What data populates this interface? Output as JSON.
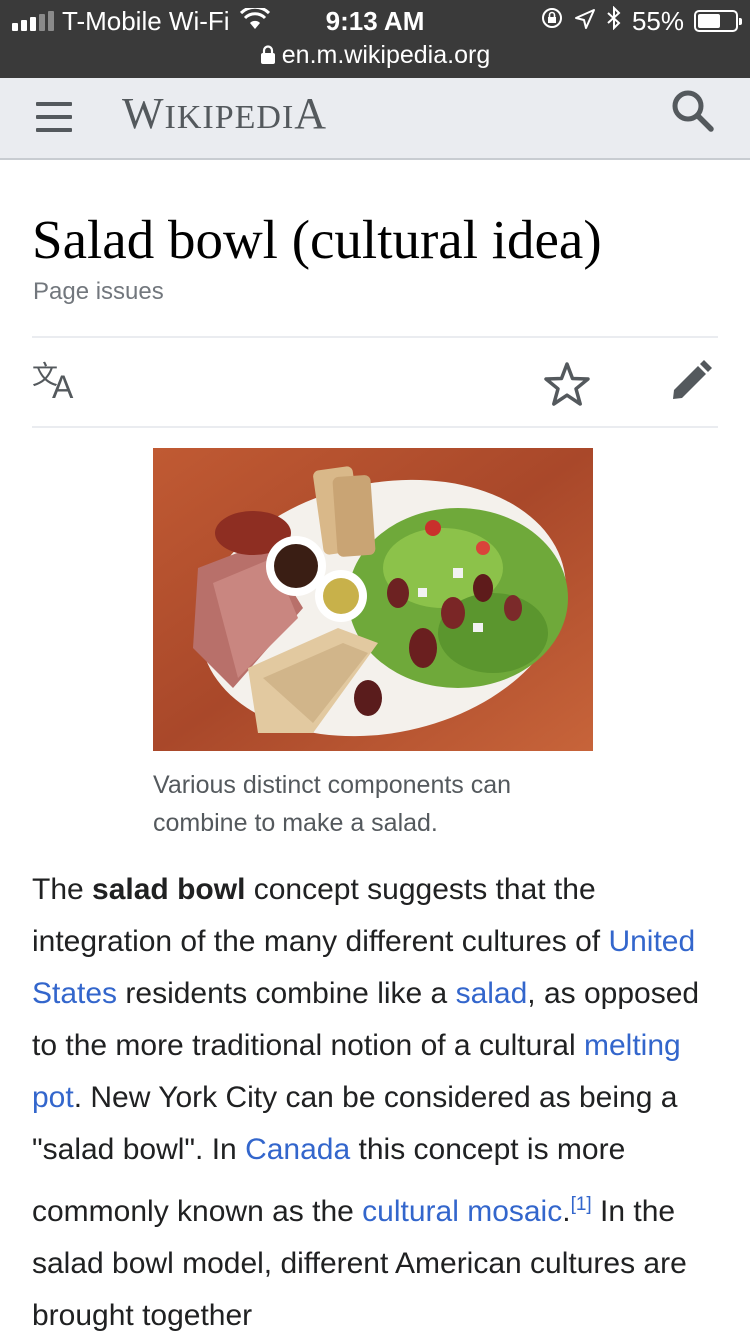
{
  "status_bar": {
    "carrier": "T-Mobile Wi-Fi",
    "time": "9:13 AM",
    "battery_percent": "55%",
    "battery_level": 0.55,
    "url": "en.m.wikipedia.org",
    "icons": [
      "signal-icon",
      "wifi-icon",
      "orientation-lock-icon",
      "location-arrow-icon",
      "bluetooth-icon",
      "battery-icon",
      "lock-icon"
    ]
  },
  "header": {
    "wordmark": "Wikipedia",
    "icons": [
      "menu-icon",
      "search-icon"
    ],
    "background": "#eaecf0"
  },
  "article": {
    "title": "Salad bowl (cultural idea)",
    "page_issues": "Page issues",
    "action_icons": [
      "language-icon",
      "watch-star-icon",
      "edit-pencil-icon"
    ],
    "image": {
      "caption": "Various distinct components can combine to make a salad."
    },
    "paragraph": {
      "t1": "The ",
      "bold": "salad bowl",
      "t2": " concept suggests that the integration of the many different cultures of ",
      "link_united_states": "United States",
      "t3": " residents combine like a ",
      "link_salad": "salad",
      "t4": ", as opposed to the more traditional notion of a cultural ",
      "link_melting_pot": "melting pot",
      "t5": ". New York City can be considered as being a \"salad bowl\". In ",
      "link_canada": "Canada",
      "t6": " this concept is more commonly known as the ",
      "link_cultural_mosaic": "cultural mosaic",
      "t7": ".",
      "ref": "[1]",
      "t8": " In the salad bowl model, different American cultures are brought together"
    },
    "link_color": "#3366cc"
  }
}
